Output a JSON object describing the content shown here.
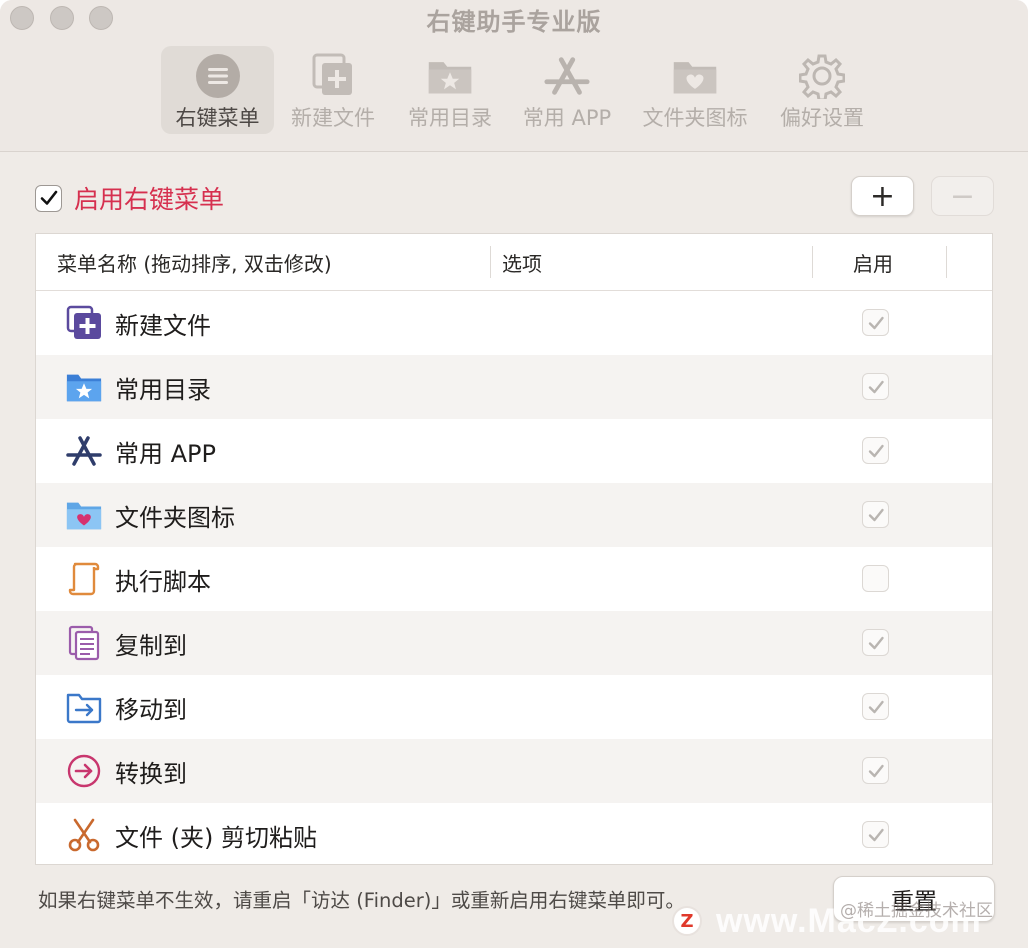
{
  "window": {
    "title": "右键助手专业版"
  },
  "toolbar": {
    "tabs": [
      {
        "label": "右键菜单",
        "icon": "menu-circle-icon",
        "active": true
      },
      {
        "label": "新建文件",
        "icon": "new-file-icon",
        "active": false
      },
      {
        "label": "常用目录",
        "icon": "folder-star-icon",
        "active": false
      },
      {
        "label": "常用 APP",
        "icon": "app-store-icon",
        "active": false
      },
      {
        "label": "文件夹图标",
        "icon": "folder-heart-icon",
        "active": false
      },
      {
        "label": "偏好设置",
        "icon": "gear-icon",
        "active": false
      }
    ]
  },
  "enable": {
    "label": "启用右键菜单",
    "checked": true
  },
  "buttons": {
    "add": "+",
    "remove": "−",
    "reset": "重置"
  },
  "table": {
    "headers": {
      "name": "菜单名称 (拖动排序, 双击修改)",
      "option": "选项",
      "enabled": "启用"
    },
    "rows": [
      {
        "label": "新建文件",
        "icon": "new-file-icon",
        "enabled": true
      },
      {
        "label": "常用目录",
        "icon": "folder-star-icon",
        "enabled": true
      },
      {
        "label": "常用 APP",
        "icon": "app-store-icon",
        "enabled": true
      },
      {
        "label": "文件夹图标",
        "icon": "folder-heart-icon",
        "enabled": true
      },
      {
        "label": "执行脚本",
        "icon": "script-scroll-icon",
        "enabled": false
      },
      {
        "label": "复制到",
        "icon": "copy-document-icon",
        "enabled": true
      },
      {
        "label": "移动到",
        "icon": "move-folder-icon",
        "enabled": true
      },
      {
        "label": "转换到",
        "icon": "convert-arrow-icon",
        "enabled": true
      },
      {
        "label": "文件 (夹) 剪切粘贴",
        "icon": "scissors-icon",
        "enabled": true
      }
    ]
  },
  "footer": {
    "hint": "如果右键菜单不生效，请重启「访达 (Finder)」或重新启用右键菜单即可。"
  },
  "watermark": {
    "logo": "Z",
    "text": "www.MacZ.com",
    "small": "@稀土掘金技术社区"
  },
  "colors": {
    "accent_red": "#d6304f",
    "purple": "#5b4a9e",
    "blue": "#3b7fd6",
    "orange": "#e08a3c",
    "pink": "#c8366e"
  }
}
